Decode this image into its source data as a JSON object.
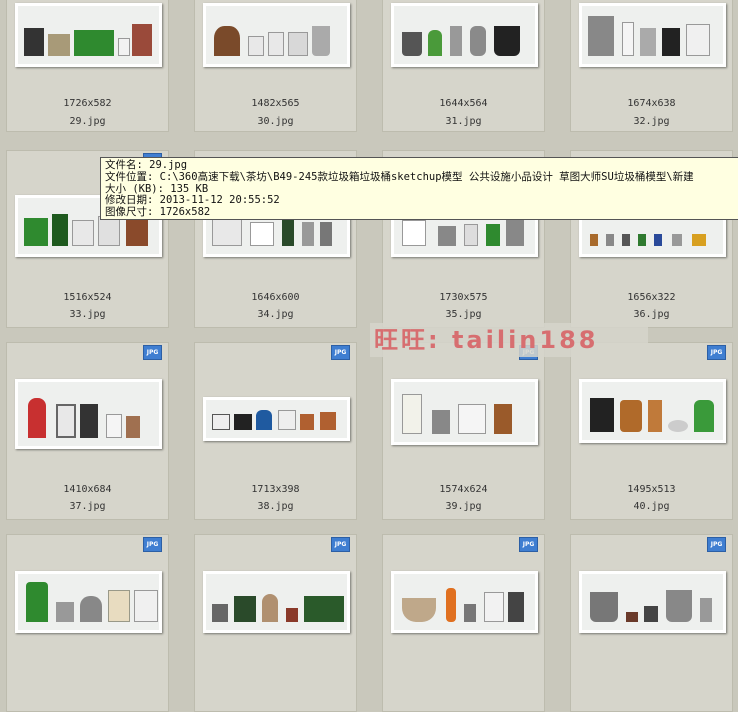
{
  "tiles": [
    {
      "dims": "1726x582",
      "name": "29.jpg"
    },
    {
      "dims": "1482x565",
      "name": "30.jpg"
    },
    {
      "dims": "1644x564",
      "name": "31.jpg"
    },
    {
      "dims": "1674x638",
      "name": "32.jpg"
    },
    {
      "dims": "1516x524",
      "name": "33.jpg"
    },
    {
      "dims": "1646x600",
      "name": "34.jpg"
    },
    {
      "dims": "1730x575",
      "name": "35.jpg"
    },
    {
      "dims": "1656x322",
      "name": "36.jpg"
    },
    {
      "dims": "1410x684",
      "name": "37.jpg"
    },
    {
      "dims": "1713x398",
      "name": "38.jpg"
    },
    {
      "dims": "1574x624",
      "name": "39.jpg"
    },
    {
      "dims": "1495x513",
      "name": "40.jpg"
    }
  ],
  "badge_text": "JPG",
  "tooltip": {
    "line1": "文件名: 29.jpg",
    "line2": "文件位置: C:\\360高速下载\\茶坊\\B49-245款垃圾箱垃圾桶sketchup模型 公共设施小品设计 草图大师SU垃圾桶模型\\新建",
    "line3": "大小 (KB): 135 KB",
    "line4": "修改日期: 2013-11-12 20:55:52",
    "line5": "图像尺寸: 1726x582"
  },
  "watermark": "旺旺: tailin188",
  "colors": {
    "bin_green": "#2f8a2f",
    "bin_gray": "#8a8a8a",
    "bin_brown": "#8a5a2b",
    "bin_black": "#222"
  }
}
